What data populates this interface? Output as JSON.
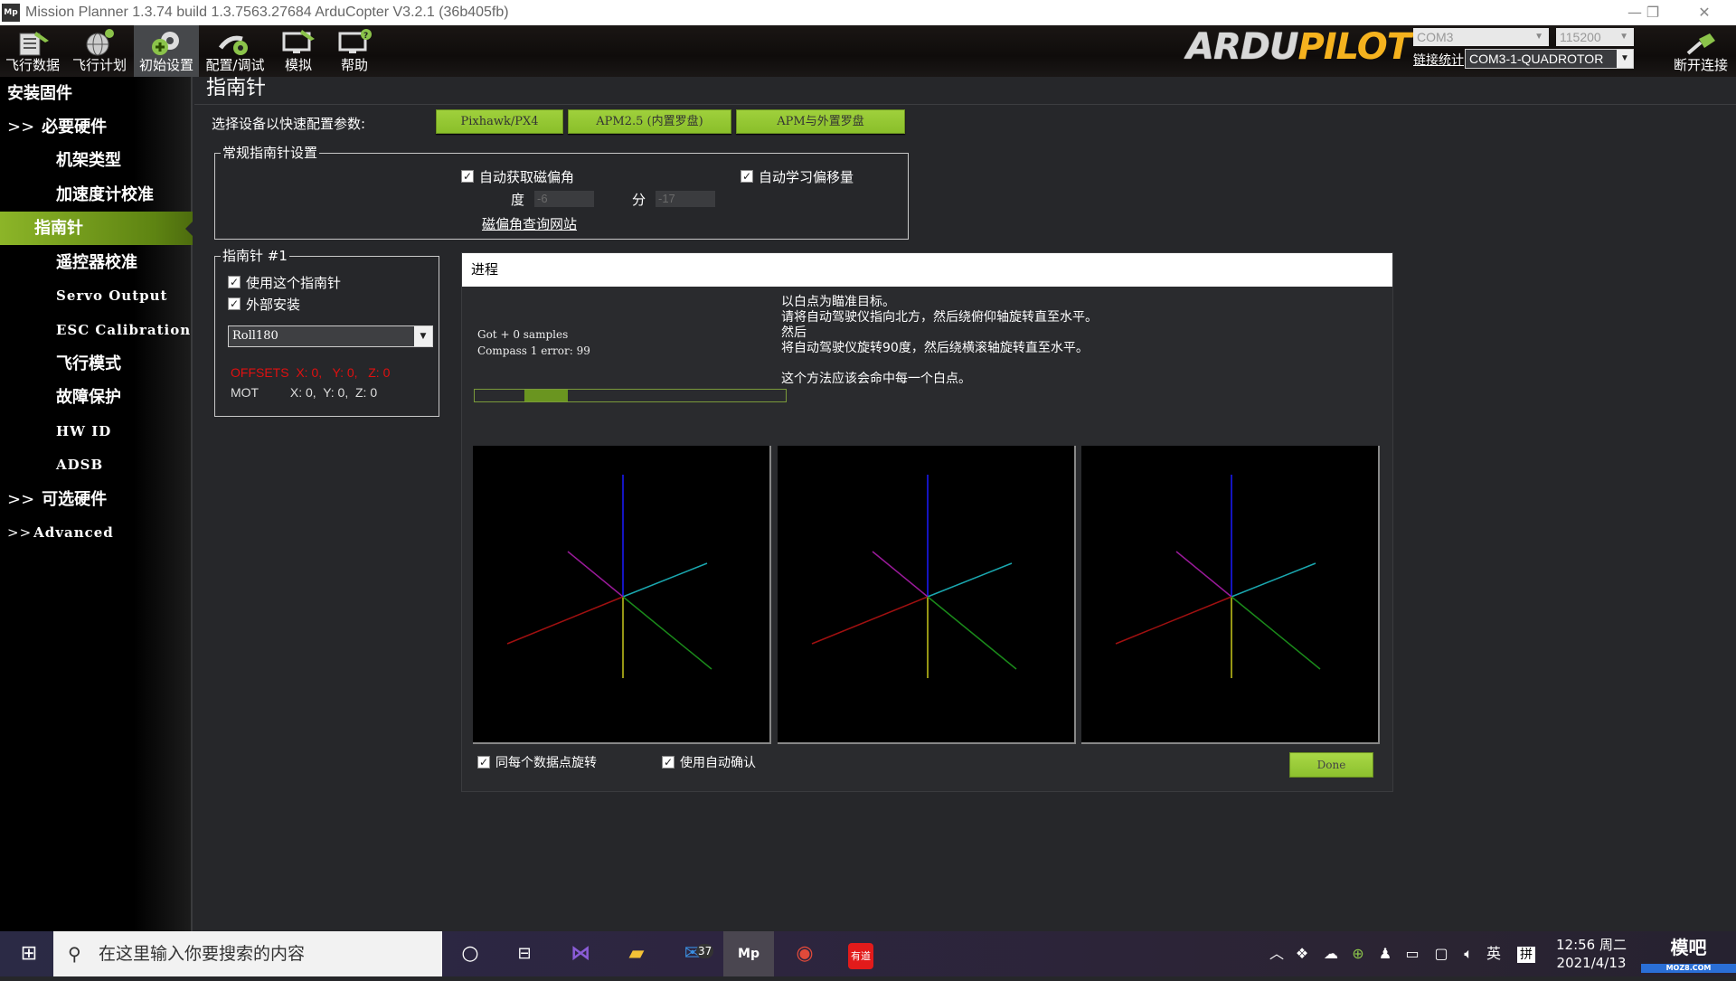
{
  "window": {
    "app_icon": "Mp",
    "title": "Mission Planner 1.3.74 build 1.3.7563.27684 ArduCopter V3.2.1 (36b405fb)",
    "controls": [
      "minimize",
      "restore",
      "close"
    ]
  },
  "toolbar": {
    "items": [
      {
        "label": "飞行数据",
        "icon": "flight-data-icon"
      },
      {
        "label": "飞行计划",
        "icon": "flight-plan-icon"
      },
      {
        "label": "初始设置",
        "icon": "initial-setup-icon",
        "active": true
      },
      {
        "label": "配置/调试",
        "icon": "config-tuning-icon"
      },
      {
        "label": "模拟",
        "icon": "simulation-icon"
      },
      {
        "label": "帮助",
        "icon": "help-icon"
      }
    ],
    "logo_ardu": "ARDU",
    "logo_pilot": "PILOT",
    "port": "COM3",
    "baud": "115200",
    "link_stats": "链接统计",
    "vehicle": "COM3-1-QUADROTOR",
    "disconnect": "断开连接"
  },
  "sidebar": {
    "items": [
      {
        "label": "安装固件",
        "level": 0
      },
      {
        "label": "必要硬件",
        "level": 0,
        "prefix": ">>"
      },
      {
        "label": "机架类型",
        "level": 1
      },
      {
        "label": "加速度计校准",
        "level": 1
      },
      {
        "label": "指南针",
        "level": 1,
        "active": true
      },
      {
        "label": "遥控器校准",
        "level": 1
      },
      {
        "label": "Servo Output",
        "level": 1
      },
      {
        "label": "ESC Calibration",
        "level": 1
      },
      {
        "label": "飞行模式",
        "level": 1
      },
      {
        "label": "故障保护",
        "level": 1
      },
      {
        "label": "HW ID",
        "level": 1
      },
      {
        "label": "ADSB",
        "level": 1
      },
      {
        "label": "可选硬件",
        "level": 0,
        "prefix": ">>"
      },
      {
        "label": "Advanced",
        "level": 0,
        "prefix": ">>"
      }
    ]
  },
  "page": {
    "title": "指南针",
    "quick_config_label": "选择设备以快速配置参数:",
    "quick_buttons": [
      "Pixhawk/PX4",
      "APM2.5 (内置罗盘)",
      "APM与外置罗盘"
    ],
    "general": {
      "legend": "常规指南针设置",
      "auto_declination": {
        "label": "自动获取磁偏角",
        "checked": true
      },
      "auto_learn": {
        "label": "自动学习偏移量",
        "checked": true
      },
      "deg_label": "度",
      "deg_value": "-6",
      "min_label": "分",
      "min_value": "-17",
      "lookup_link": "磁偏角查询网站"
    },
    "compass1": {
      "legend": "指南针 #1",
      "use": {
        "label": "使用这个指南针",
        "checked": true
      },
      "external": {
        "label": "外部安装",
        "checked": true
      },
      "orientation": "Roll180",
      "offsets_label": "OFFSETS",
      "offsets": "X: 0,   Y: 0,   Z: 0",
      "mot_label": "MOT",
      "mot": "X: 0,  Y: 0,  Z: 0",
      "offsets_color": "#e01010"
    },
    "progress": {
      "title": "进程",
      "status_lines": "Got + 0 samples\nCompass 1 error: 99",
      "instructions": "以白点为瞄准目标。\n请将自动驾驶仪指向北方，然后绕俯仰轴旋转直至水平。\n然后\n将自动驾驶仪旋转90度，然后绕横滚轴旋转直至水平。\n\n这个方法应该会命中每一个白点。",
      "progress_fill_start": 0.16,
      "progress_fill_end": 0.3,
      "rotate_each": {
        "label": "同每个数据点旋转",
        "checked": true
      },
      "auto_accept": {
        "label": "使用自动确认",
        "checked": true
      },
      "done": "Done"
    },
    "views": [
      {
        "name": "view-1"
      },
      {
        "name": "view-2"
      },
      {
        "name": "view-3"
      }
    ],
    "axis_colors": {
      "blue": "#1a1aff",
      "cyan": "#1aa8b0",
      "magenta": "#9a1a9a",
      "red": "#a01010",
      "green": "#1a8a1a",
      "yellow": "#c8c81a"
    }
  },
  "taskbar": {
    "search_placeholder": "在这里输入你要搜索的内容",
    "mail_badge": "37",
    "youdao": "有道",
    "ime_lang": "英",
    "ime_mode": "拼",
    "time": "12:56 周二",
    "date": "2021/4/13",
    "watermark": "模吧",
    "watermark_sub": "MOZ8.COM"
  },
  "colors": {
    "accent_green": "#8cbf2a",
    "panel_bg": "#26272a"
  }
}
